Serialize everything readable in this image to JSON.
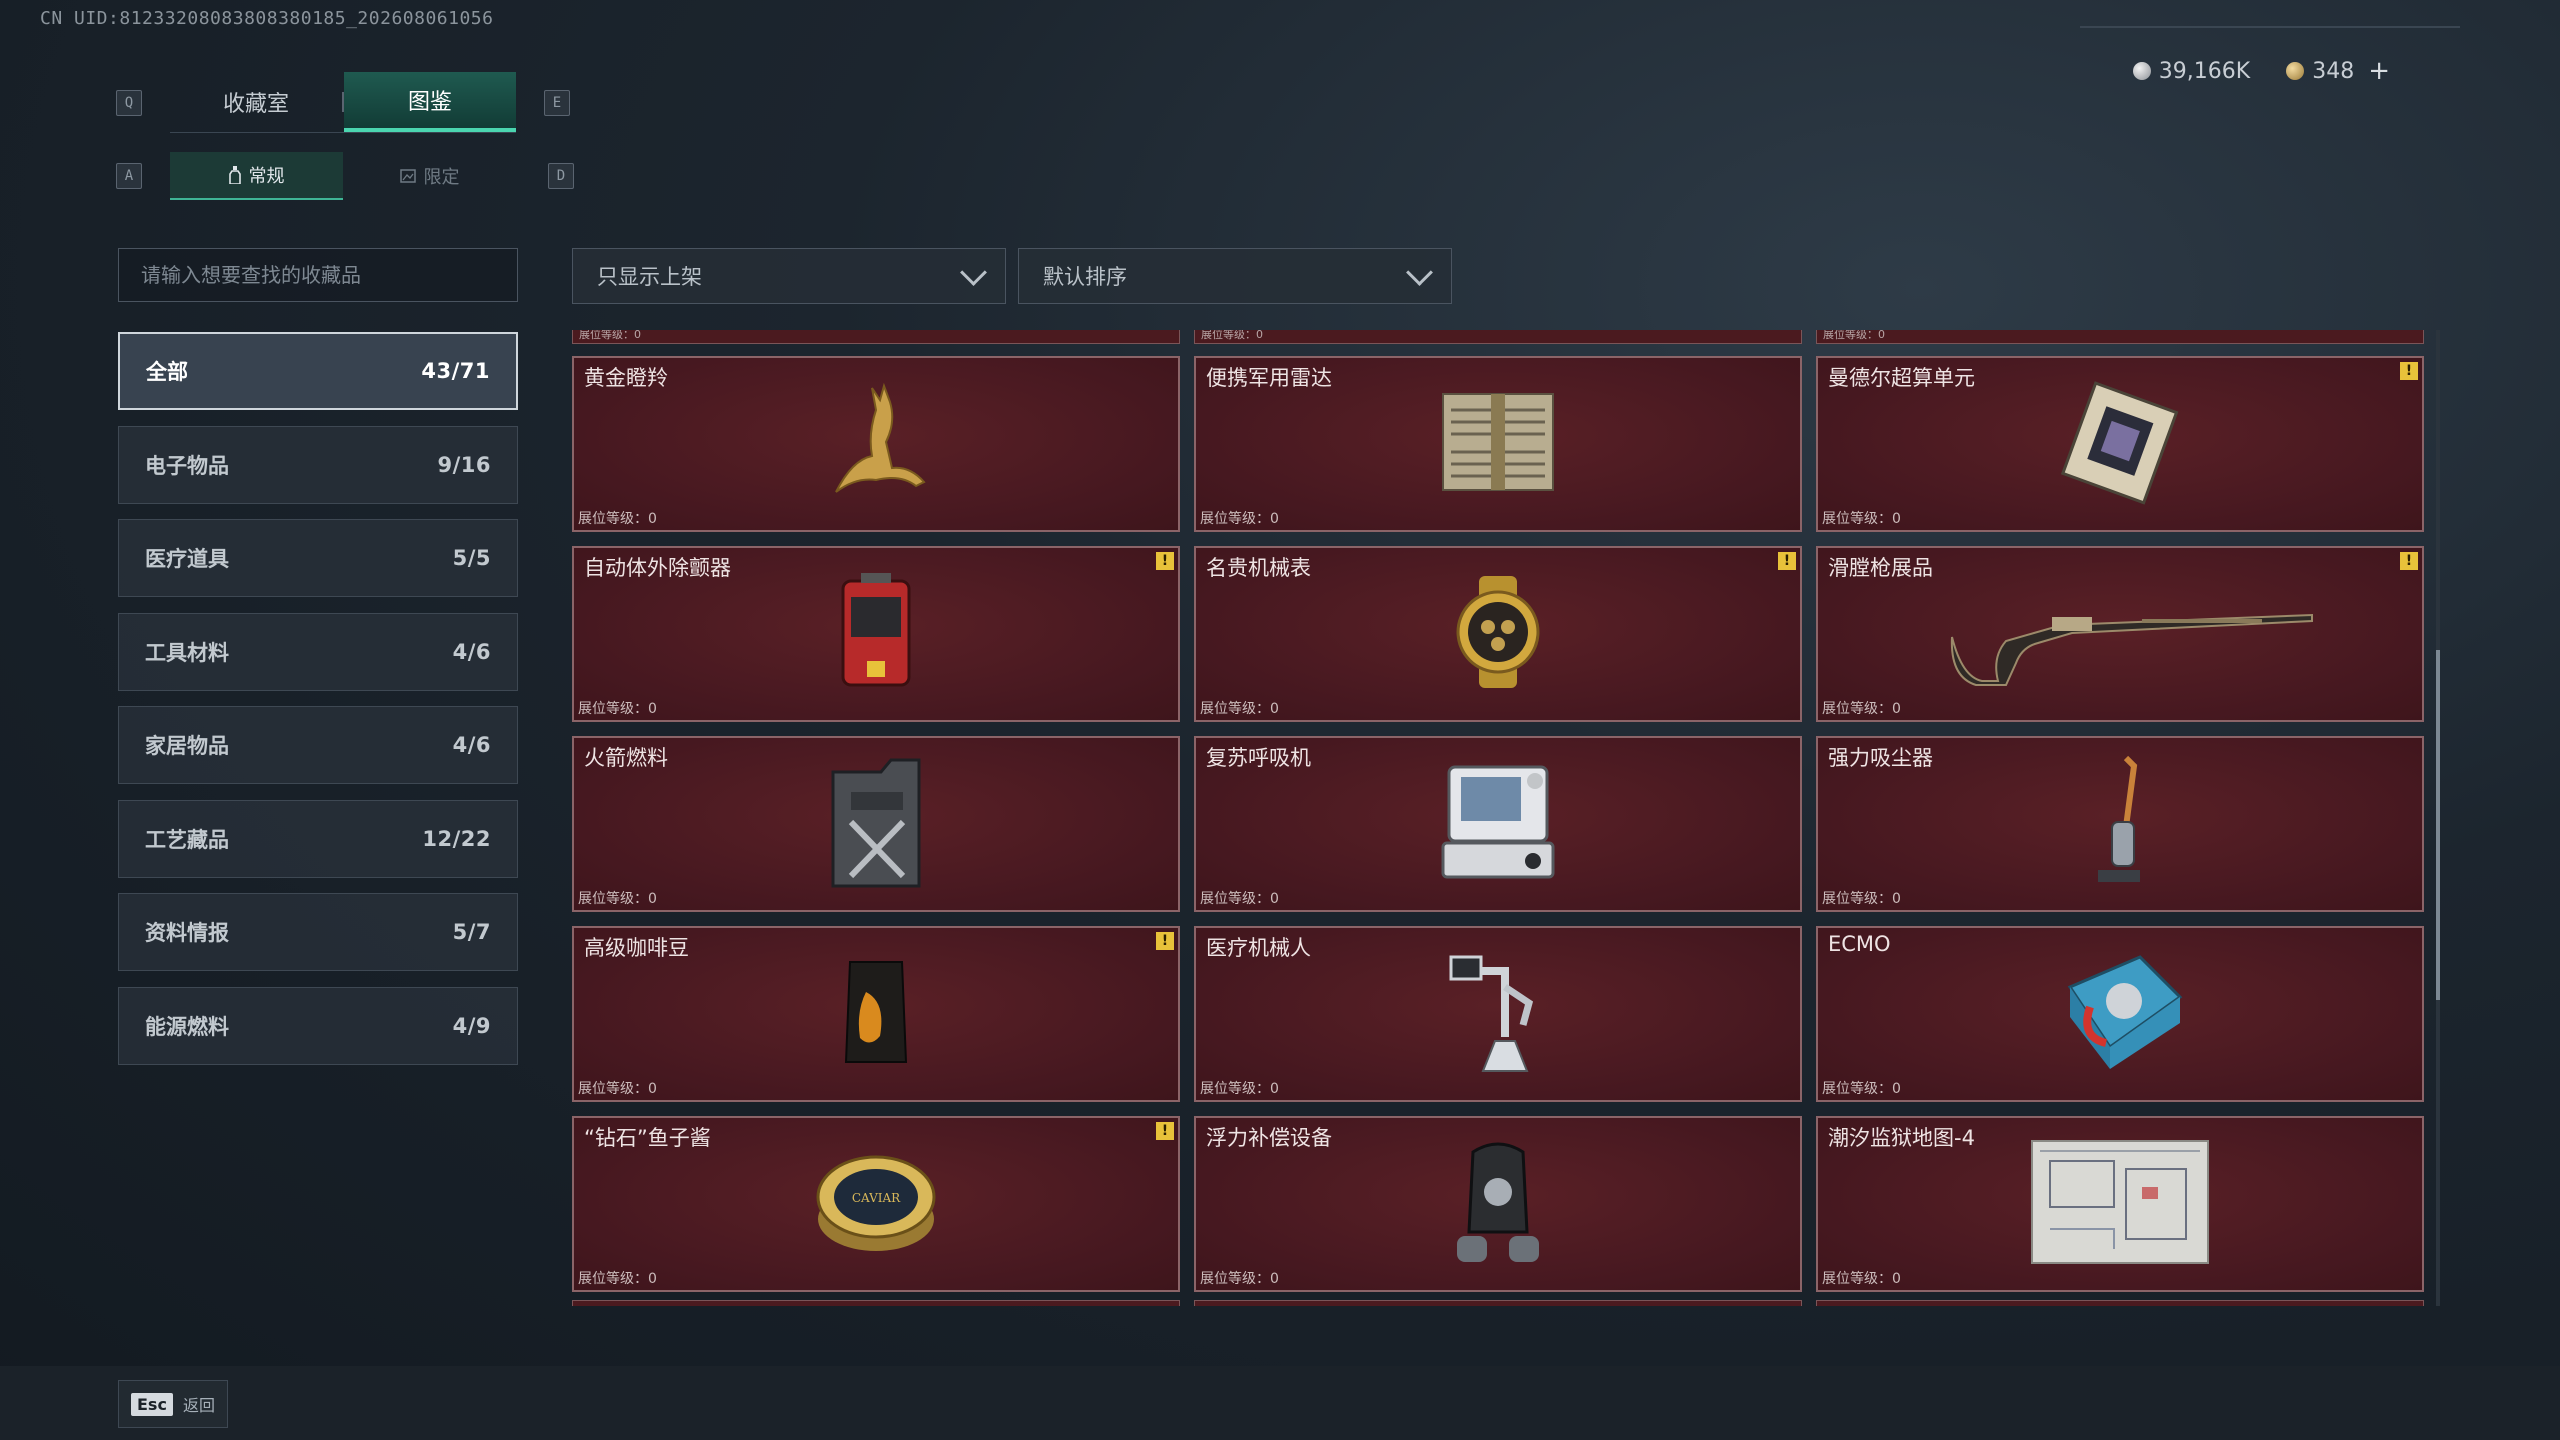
{
  "uid": "CN UID:81233208083808380185_202608061056",
  "currency": {
    "silver": "39,166K",
    "gold": "348",
    "add_symbol": "+"
  },
  "keys": {
    "q": "Q",
    "e": "E",
    "a": "A",
    "d": "D"
  },
  "tabs": [
    {
      "label": "收藏室"
    },
    {
      "label": "图鉴",
      "active": true
    }
  ],
  "subtabs": [
    {
      "label": "常规",
      "active": true
    },
    {
      "label": "限定"
    }
  ],
  "search": {
    "placeholder": "请输入想要查找的收藏品"
  },
  "filters": {
    "shelf": "只显示上架",
    "sort": "默认排序"
  },
  "categories": [
    {
      "label": "全部",
      "count": "43/71",
      "active": true
    },
    {
      "label": "电子物品",
      "count": "9/16"
    },
    {
      "label": "医疗道具",
      "count": "5/5"
    },
    {
      "label": "工具材料",
      "count": "4/6"
    },
    {
      "label": "家居物品",
      "count": "4/6"
    },
    {
      "label": "工艺藏品",
      "count": "12/22"
    },
    {
      "label": "资料情报",
      "count": "5/7"
    },
    {
      "label": "能源燃料",
      "count": "4/9"
    }
  ],
  "level_label": "展位等级：0",
  "warn_symbol": "!",
  "items": [
    {
      "name": "黄金瞪羚",
      "warn": false,
      "icon": "gazelle-statue-icon"
    },
    {
      "name": "便携军用雷达",
      "warn": false,
      "icon": "radar-icon"
    },
    {
      "name": "曼德尔超算单元",
      "warn": true,
      "icon": "supercomputer-chip-icon"
    },
    {
      "name": "自动体外除颤器",
      "warn": true,
      "icon": "defibrillator-icon"
    },
    {
      "name": "名贵机械表",
      "warn": true,
      "icon": "watch-icon"
    },
    {
      "name": "滑膛枪展品",
      "warn": true,
      "icon": "musket-icon"
    },
    {
      "name": "火箭燃料",
      "warn": false,
      "icon": "fuel-can-icon"
    },
    {
      "name": "复苏呼吸机",
      "warn": false,
      "icon": "ventilator-icon"
    },
    {
      "name": "强力吸尘器",
      "warn": false,
      "icon": "vacuum-icon"
    },
    {
      "name": "高级咖啡豆",
      "warn": true,
      "icon": "coffee-bag-icon"
    },
    {
      "name": "医疗机械人",
      "warn": false,
      "icon": "medical-robot-icon"
    },
    {
      "name": "ECMO",
      "warn": false,
      "icon": "ecmo-icon"
    },
    {
      "name": "“钻石”鱼子酱",
      "warn": true,
      "icon": "caviar-tin-icon"
    },
    {
      "name": "浮力补偿设备",
      "warn": false,
      "icon": "bcd-vest-icon"
    },
    {
      "name": "潮汐监狱地图-4",
      "warn": false,
      "icon": "map-icon"
    }
  ],
  "caviar_label": "CAVIAR",
  "footer": {
    "esc_key": "Esc",
    "back_label": "返回"
  }
}
